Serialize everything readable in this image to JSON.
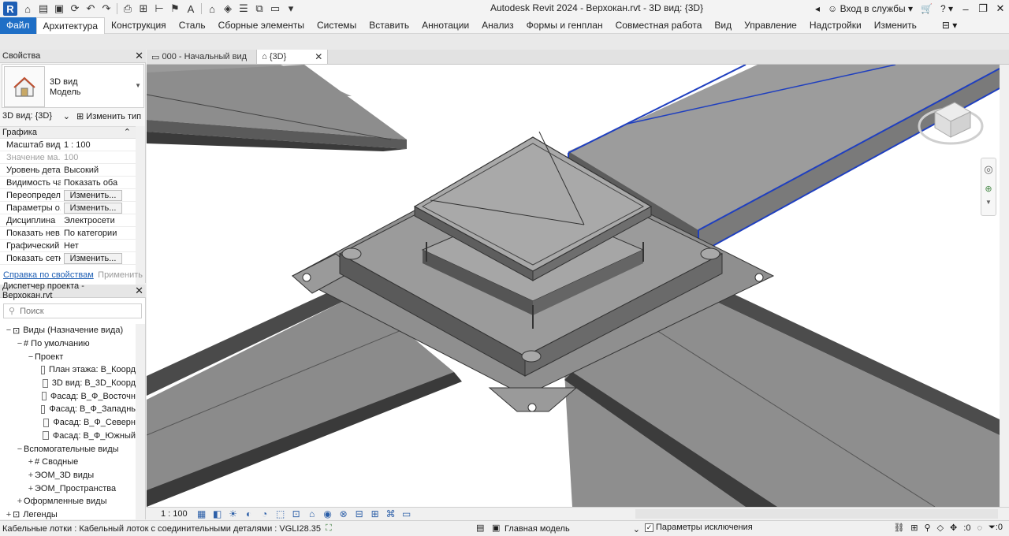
{
  "title_bar": {
    "logo": "R",
    "window_title": "Autodesk Revit 2024 - Верхокан.rvt - 3D вид: {3D}",
    "signin_label": "Вход в службы",
    "help_label": "?"
  },
  "ribbon": {
    "tabs": [
      {
        "label": "Файл"
      },
      {
        "label": "Архитектура"
      },
      {
        "label": "Конструкция"
      },
      {
        "label": "Сталь"
      },
      {
        "label": "Сборные элементы"
      },
      {
        "label": "Системы"
      },
      {
        "label": "Вставить"
      },
      {
        "label": "Аннотации"
      },
      {
        "label": "Анализ"
      },
      {
        "label": "Формы и генплан"
      },
      {
        "label": "Совместная работа"
      },
      {
        "label": "Вид"
      },
      {
        "label": "Управление"
      },
      {
        "label": "Надстройки"
      },
      {
        "label": "Изменить"
      }
    ]
  },
  "properties": {
    "title": "Свойства",
    "type_line1": "3D вид",
    "type_line2": "Модель",
    "instance_select": "3D вид: {3D}",
    "edit_type": "Изменить тип",
    "group": "Графика",
    "rows": [
      {
        "name": "Масштаб вида",
        "value": "1 : 100",
        "button": ""
      },
      {
        "name": "Значение ма...",
        "value": "100",
        "button": ""
      },
      {
        "name": "Уровень дета...",
        "value": "Высокий",
        "button": ""
      },
      {
        "name": "Видимость ча...",
        "value": "Показать оба",
        "button": ""
      },
      {
        "name": "Переопредел...",
        "value": "",
        "button": "Изменить..."
      },
      {
        "name": "Параметры о...",
        "value": "",
        "button": "Изменить..."
      },
      {
        "name": "Дисциплина",
        "value": "Электросети",
        "button": ""
      },
      {
        "name": "Показать нев...",
        "value": "По категории",
        "button": ""
      },
      {
        "name": "Графический ...",
        "value": "Нет",
        "button": ""
      },
      {
        "name": "Показать сетки",
        "value": "",
        "button": "Изменить..."
      }
    ],
    "help_link": "Справка по свойствам",
    "apply": "Применить"
  },
  "project_browser": {
    "title": "Диспетчер проекта - Верхокан.rvt",
    "search_placeholder": "Поиск",
    "tree": [
      {
        "toggle": "−",
        "label": "Виды (Назначение вида)",
        "indent": 0
      },
      {
        "toggle": "−",
        "label": "# По умолчанию",
        "indent": 1
      },
      {
        "toggle": "−",
        "label": "Проект",
        "indent": 2
      },
      {
        "toggle": "",
        "label": "План этажа: В_Коорд",
        "indent": 3
      },
      {
        "toggle": "",
        "label": "3D вид: В_3D_Коорд",
        "indent": 3
      },
      {
        "toggle": "",
        "label": "Фасад: В_Ф_Восточн",
        "indent": 3
      },
      {
        "toggle": "",
        "label": "Фасад: В_Ф_Западнь",
        "indent": 3
      },
      {
        "toggle": "",
        "label": "Фасад: В_Ф_Северн",
        "indent": 3
      },
      {
        "toggle": "",
        "label": "Фасад: В_Ф_Южный",
        "indent": 3
      },
      {
        "toggle": "−",
        "label": "Вспомогательные виды",
        "indent": 1
      },
      {
        "toggle": "+",
        "label": "# Сводные",
        "indent": 2
      },
      {
        "toggle": "+",
        "label": "ЭОМ_3D виды",
        "indent": 2
      },
      {
        "toggle": "+",
        "label": "ЭОМ_Пространства",
        "indent": 2
      },
      {
        "toggle": "+",
        "label": "Оформленные виды",
        "indent": 1
      },
      {
        "toggle": "+",
        "label": "Легенды",
        "indent": 0
      }
    ]
  },
  "view_tabs": [
    {
      "label": "000 - Начальный вид",
      "active": false
    },
    {
      "label": "{3D}",
      "active": true
    }
  ],
  "view_bar": {
    "scale": "1 : 100"
  },
  "status_bar": {
    "text": "Кабельные лотки : Кабельный лоток с соединительными деталями : VGLI28.35",
    "model": "Главная модель",
    "exclusions_label": "Параметры исключения",
    "selection_count": ":0",
    "filter_count": ":0"
  },
  "colors": {
    "file_tab": "#1f6fc6",
    "selection_highlight": "#1f3fbf",
    "tray_fill": "#8a8a8a"
  }
}
